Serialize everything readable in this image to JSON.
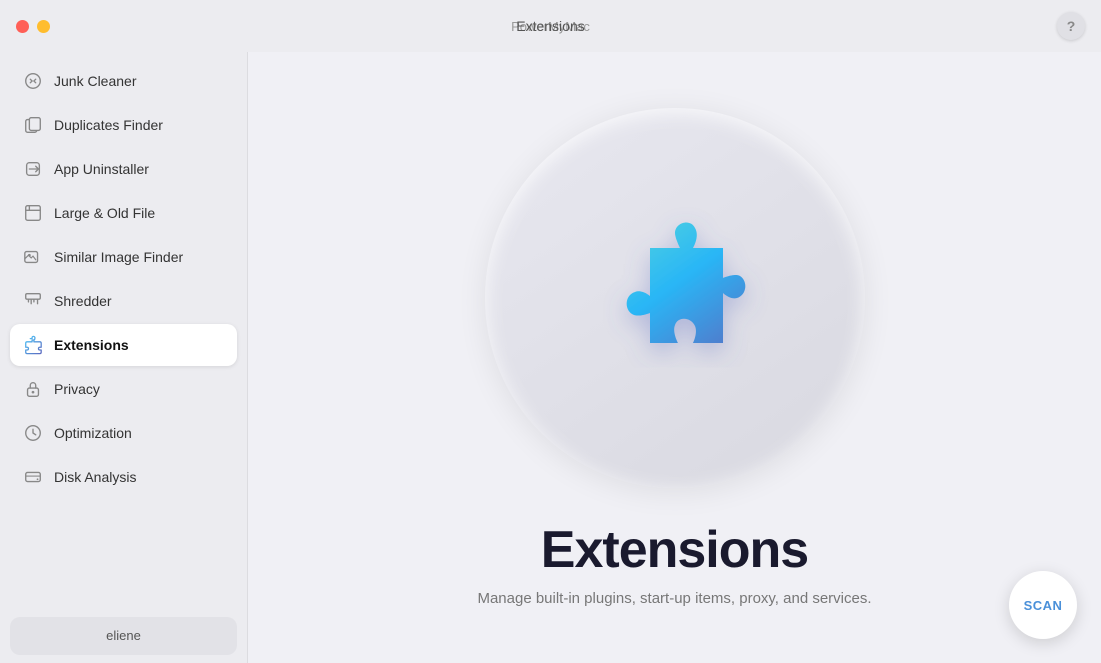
{
  "titlebar": {
    "app_name": "PowerMyMac",
    "header_title": "Extensions",
    "help_label": "?"
  },
  "sidebar": {
    "items": [
      {
        "id": "junk-cleaner",
        "label": "Junk Cleaner",
        "icon": "junk-icon",
        "active": false
      },
      {
        "id": "duplicates-finder",
        "label": "Duplicates Finder",
        "icon": "duplicates-icon",
        "active": false
      },
      {
        "id": "app-uninstaller",
        "label": "App Uninstaller",
        "icon": "uninstaller-icon",
        "active": false
      },
      {
        "id": "large-old-file",
        "label": "Large & Old File",
        "icon": "large-file-icon",
        "active": false
      },
      {
        "id": "similar-image-finder",
        "label": "Similar Image Finder",
        "icon": "image-icon",
        "active": false
      },
      {
        "id": "shredder",
        "label": "Shredder",
        "icon": "shredder-icon",
        "active": false
      },
      {
        "id": "extensions",
        "label": "Extensions",
        "icon": "extensions-icon",
        "active": true
      },
      {
        "id": "privacy",
        "label": "Privacy",
        "icon": "privacy-icon",
        "active": false
      },
      {
        "id": "optimization",
        "label": "Optimization",
        "icon": "optimization-icon",
        "active": false
      },
      {
        "id": "disk-analysis",
        "label": "Disk Analysis",
        "icon": "disk-icon",
        "active": false
      }
    ],
    "user": {
      "name": "eliene"
    }
  },
  "content": {
    "title": "Extensions",
    "subtitle": "Manage built-in plugins, start-up items, proxy, and services.",
    "scan_label": "SCAN"
  }
}
